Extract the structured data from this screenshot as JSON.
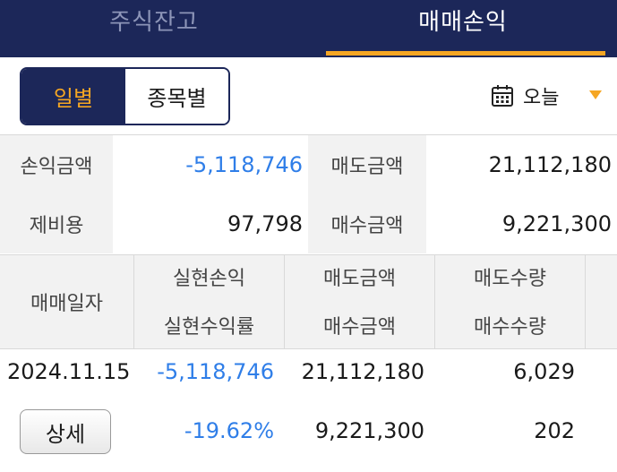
{
  "tabs": [
    {
      "label": "주식잔고",
      "active": false
    },
    {
      "label": "매매손익",
      "active": true
    }
  ],
  "segment": {
    "daily": "일별",
    "by_stock": "종목별",
    "selected": "daily"
  },
  "date_selector": {
    "label": "오늘"
  },
  "summary": {
    "pl_label": "손익금액",
    "pl_value": "-5,118,746",
    "sell_label": "매도금액",
    "sell_value": "21,112,180",
    "fee_label": "제비용",
    "fee_value": "97,798",
    "buy_label": "매수금액",
    "buy_value": "9,221,300"
  },
  "table": {
    "headers": {
      "date": "매매일자",
      "realized_pl": "실현손익",
      "realized_rate": "실현수익률",
      "sell_amount": "매도금액",
      "buy_amount": "매수금액",
      "sell_qty": "매도수량",
      "buy_qty": "매수수량"
    },
    "rows": [
      {
        "date": "2024.11.15",
        "detail_button": "상세",
        "realized_pl": "-5,118,746",
        "realized_rate": "-19.62%",
        "sell_amount": "21,112,180",
        "buy_amount": "9,221,300",
        "sell_qty": "6,029",
        "buy_qty": "202"
      }
    ]
  },
  "colors": {
    "navy": "#1c2759",
    "accent": "#f5a623",
    "negative": "#2f7ee8"
  }
}
